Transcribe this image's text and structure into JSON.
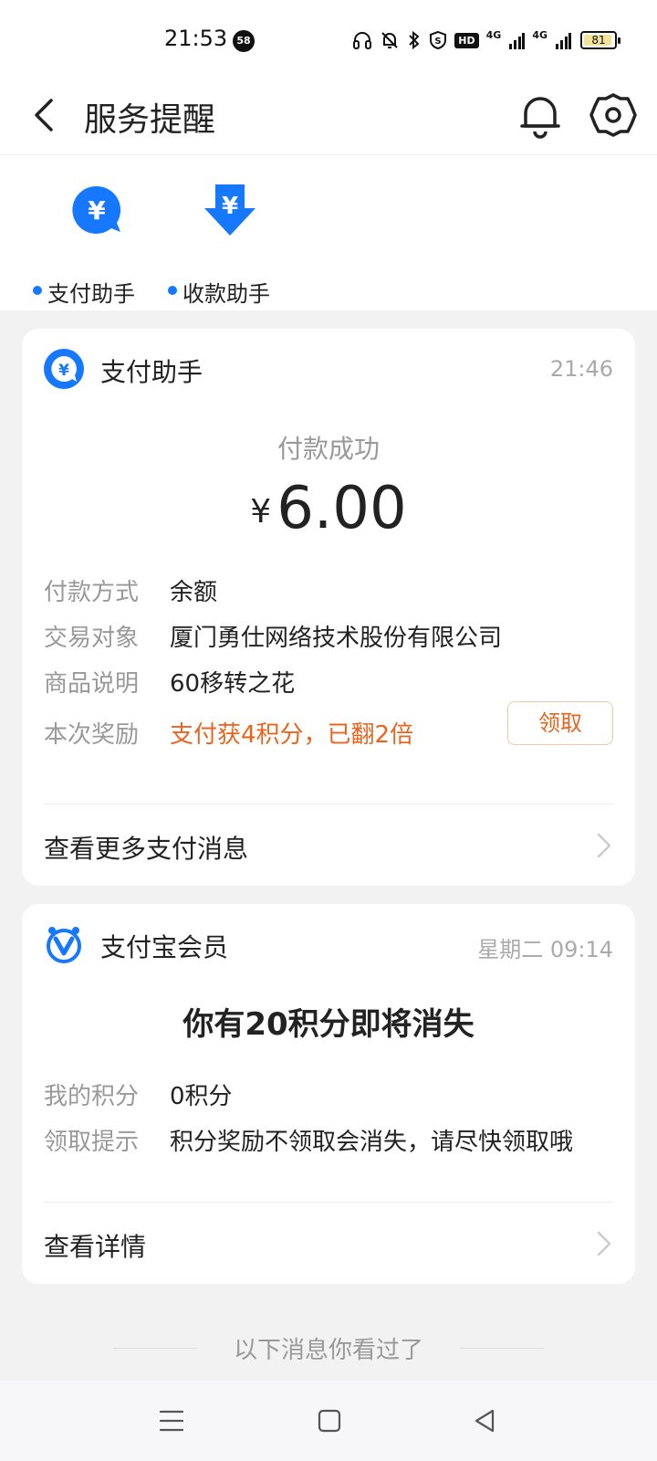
{
  "status_bar": {
    "time": "21:53",
    "notification_count": "58",
    "battery": "81",
    "network_1": "4G",
    "network_2": "4G",
    "hd_label": "HD"
  },
  "header": {
    "title": "服务提醒",
    "icons": [
      "back-icon",
      "bell-icon",
      "gear-icon"
    ]
  },
  "assistants": [
    {
      "label": "支付助手",
      "icon": "yuan-chat-icon"
    },
    {
      "label": "收款助手",
      "icon": "yuan-down-arrow-icon"
    }
  ],
  "payment_card": {
    "title": "支付助手",
    "time": "21:46",
    "status": "付款成功",
    "currency": "¥",
    "amount": "6.00",
    "rows": [
      {
        "key": "付款方式",
        "value": "余额"
      },
      {
        "key": "交易对象",
        "value": "厦门勇仕网络技术股份有限公司"
      },
      {
        "key": "商品说明",
        "value": "60移转之花"
      },
      {
        "key": "本次奖励",
        "value": "支付获4积分，已翻2倍"
      }
    ],
    "claim_label": "领取",
    "more_label": "查看更多支付消息"
  },
  "member_card": {
    "title": "支付宝会员",
    "time": "星期二 09:14",
    "headline": "你有20积分即将消失",
    "rows": [
      {
        "key": "我的积分",
        "value": "0积分"
      },
      {
        "key": "领取提示",
        "value": "积分奖励不领取会消失，请尽快领取哦"
      }
    ],
    "more_label": "查看详情"
  },
  "seen_divider": "以下消息你看过了",
  "colors": {
    "brand_blue": "#1677ff",
    "accent_orange": "#e8651f",
    "background": "#f2f2f2"
  }
}
